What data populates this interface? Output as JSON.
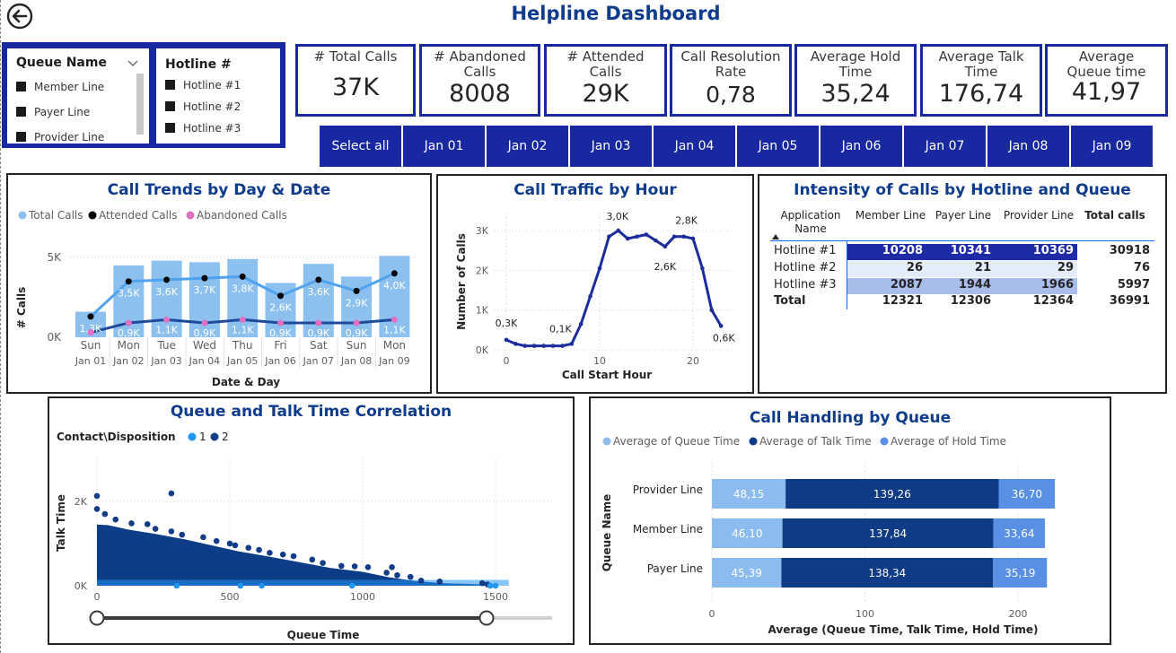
{
  "page": {
    "title": "Helpline Dashboard"
  },
  "slicers": {
    "queue_name": {
      "label": "Queue Name",
      "items": [
        "Member Line",
        "Payer Line",
        "Provider Line"
      ]
    },
    "hotline": {
      "label": "Hotline #",
      "items": [
        "Hotline #1",
        "Hotline #2",
        "Hotline #3"
      ]
    }
  },
  "kpis": [
    {
      "label": "# Total Calls",
      "value": "37K"
    },
    {
      "label": "# Abandoned Calls",
      "value": "8008"
    },
    {
      "label": "# Attended Calls",
      "value": "29K"
    },
    {
      "label": "Call Resolution Rate",
      "value": "0,78"
    },
    {
      "label": "Average Hold Time",
      "value": "35,24"
    },
    {
      "label": "Average Talk Time",
      "value": "176,74"
    },
    {
      "label": "Average Queue time",
      "value": "41,97"
    }
  ],
  "date_buttons": [
    "Select all",
    "Jan 01",
    "Jan 02",
    "Jan 03",
    "Jan 04",
    "Jan 05",
    "Jan 06",
    "Jan 07",
    "Jan 08",
    "Jan 09"
  ],
  "colors": {
    "brand": "#1728a0",
    "title": "#0e3b8c",
    "bar": "#8cc0ef",
    "attended": "#000000",
    "abandoned": "#e36fc0",
    "line1": "#4fa3ee",
    "line2": "#1f4a9a",
    "traffic": "#1b2d9c"
  },
  "trend_chart": {
    "title": "Call Trends by Day & Date",
    "legend": [
      "Total Calls",
      "Attended Calls",
      "Abandoned Calls"
    ],
    "xlabel": "Date & Day",
    "ylabel": "# Calls",
    "yticks": [
      "0K",
      "5K"
    ],
    "days": [
      "Sun",
      "Mon",
      "Tue",
      "Wed",
      "Thu",
      "Fri",
      "Sat",
      "Sun",
      "Mon"
    ],
    "dates": [
      "Jan 01",
      "Jan 02",
      "Jan 03",
      "Jan 04",
      "Jan 05",
      "Jan 06",
      "Jan 07",
      "Jan 08",
      "Jan 09"
    ]
  },
  "traffic_chart": {
    "title": "Call Traffic by Hour",
    "xlabel": "Call Start Hour",
    "ylabel": "Number of Calls",
    "yticks": [
      "0K",
      "1K",
      "2K",
      "3K"
    ],
    "xticks": [
      "0",
      "10",
      "20"
    ]
  },
  "matrix": {
    "title": "Intensity of Calls by Hotline and Queue",
    "headers": [
      "Application Name",
      "Member Line",
      "Payer Line",
      "Provider Line",
      "Total calls"
    ],
    "rows": [
      {
        "name": "Hotline #1",
        "cells": [
          "10208",
          "10341",
          "10369"
        ],
        "total": "30918"
      },
      {
        "name": "Hotline #2",
        "cells": [
          "26",
          "21",
          "29"
        ],
        "total": "76"
      },
      {
        "name": "Hotline #3",
        "cells": [
          "2087",
          "1944",
          "1966"
        ],
        "total": "5997"
      }
    ],
    "total": {
      "name": "Total",
      "cells": [
        "12321",
        "12306",
        "12364"
      ],
      "total": "36991"
    }
  },
  "scatter": {
    "title": "Queue and Talk Time Correlation",
    "legend_title": "Contact\\Disposition",
    "legend": [
      "1",
      "2"
    ],
    "xlabel": "Queue Time",
    "ylabel": "Talk Time",
    "xticks": [
      "0",
      "500",
      "1000",
      "1500"
    ],
    "yticks": [
      "0K",
      "2K"
    ],
    "slider": {
      "min": 0,
      "max": 1500
    }
  },
  "handling": {
    "title": "Call Handling by Queue",
    "legend": [
      "Average of Queue Time",
      "Average of Talk Time",
      "Average of Hold Time"
    ],
    "xlabel": "Average (Queue Time, Talk Time, Hold Time)",
    "ylabel": "Queue Name",
    "xticks": [
      "0",
      "100",
      "200"
    ]
  },
  "chart_data": [
    {
      "type": "bar",
      "title": "Call Trends by Day & Date",
      "categories": [
        "Jan 01",
        "Jan 02",
        "Jan 03",
        "Jan 04",
        "Jan 05",
        "Jan 06",
        "Jan 07",
        "Jan 08",
        "Jan 09"
      ],
      "series": [
        {
          "name": "Total Calls",
          "values": [
            1600,
            4500,
            4800,
            4700,
            4900,
            3400,
            4600,
            3800,
            5100
          ]
        },
        {
          "name": "Attended Calls",
          "values": [
            1300,
            3500,
            3600,
            3700,
            3800,
            2600,
            3600,
            2900,
            4000
          ],
          "labels": [
            "1,3K",
            "3,5K",
            "3,6K",
            "3,7K",
            "3,8K",
            "2,6K",
            "3,6K",
            "2,9K",
            "4,0K"
          ]
        },
        {
          "name": "Abandoned Calls",
          "values": [
            300,
            900,
            1100,
            900,
            1100,
            900,
            900,
            900,
            1100
          ],
          "labels": [
            "",
            "0,9K",
            "1,1K",
            "0,9K",
            "1,1K",
            "0,9K",
            "0,9K",
            "0,9K",
            "1,1K"
          ]
        }
      ],
      "ylabel": "# Calls",
      "xlabel": "Date & Day",
      "ylim": [
        0,
        6000
      ]
    },
    {
      "type": "line",
      "title": "Call Traffic by Hour",
      "x": [
        0,
        1,
        2,
        3,
        4,
        5,
        6,
        7,
        8,
        9,
        10,
        11,
        12,
        13,
        14,
        15,
        16,
        17,
        18,
        19,
        20,
        21,
        22,
        23
      ],
      "values": [
        250,
        150,
        100,
        100,
        100,
        100,
        100,
        150,
        650,
        1350,
        2050,
        2850,
        3000,
        2800,
        2850,
        2900,
        2750,
        2600,
        2850,
        2850,
        2800,
        2050,
        1000,
        600
      ],
      "labels": {
        "0": "0,3K",
        "6": "0,1K",
        "12": "3,0K",
        "17": "2,6K",
        "19": "2,8K",
        "23": "0,6K"
      },
      "xlabel": "Call Start Hour",
      "ylabel": "Number of Calls",
      "ylim": [
        0,
        3300
      ],
      "xlim": [
        -1,
        24
      ]
    },
    {
      "type": "scatter",
      "title": "Queue and Talk Time Correlation",
      "xlabel": "Queue Time",
      "ylabel": "Talk Time",
      "xlim": [
        0,
        1720
      ],
      "ylim": [
        0,
        2600
      ],
      "series": [
        {
          "name": "1",
          "points": [
            [
              540,
              0
            ],
            [
              960,
              0
            ],
            [
              1480,
              0
            ],
            [
              1500,
              0
            ],
            [
              300,
              0
            ],
            [
              620,
              0
            ]
          ]
        },
        {
          "name": "2",
          "points": [
            [
              0,
              2130
            ],
            [
              280,
              2190
            ],
            [
              0,
              1820
            ],
            [
              30,
              1700
            ],
            [
              70,
              1570
            ],
            [
              130,
              1480
            ],
            [
              190,
              1460
            ],
            [
              220,
              1350
            ],
            [
              280,
              1290
            ],
            [
              320,
              1210
            ],
            [
              400,
              1150
            ],
            [
              450,
              1060
            ],
            [
              500,
              1000
            ],
            [
              520,
              960
            ],
            [
              570,
              900
            ],
            [
              610,
              850
            ],
            [
              650,
              780
            ],
            [
              700,
              740
            ],
            [
              740,
              700
            ],
            [
              810,
              620
            ],
            [
              850,
              540
            ],
            [
              920,
              470
            ],
            [
              970,
              460
            ],
            [
              1020,
              440
            ],
            [
              1090,
              310
            ],
            [
              1110,
              440
            ],
            [
              1130,
              250
            ],
            [
              1180,
              210
            ],
            [
              1220,
              120
            ],
            [
              1290,
              100
            ],
            [
              1450,
              60
            ],
            [
              1470,
              30
            ]
          ]
        }
      ]
    },
    {
      "type": "bar",
      "title": "Call Handling by Queue",
      "categories": [
        "Provider Line",
        "Member Line",
        "Payer Line"
      ],
      "series": [
        {
          "name": "Average of Queue Time",
          "values": [
            48.15,
            46.1,
            45.39
          ],
          "labels": [
            "48,15",
            "46,10",
            "45,39"
          ]
        },
        {
          "name": "Average of Talk Time",
          "values": [
            139.26,
            137.84,
            138.34
          ],
          "labels": [
            "139,26",
            "137,84",
            "138,34"
          ]
        },
        {
          "name": "Average of Hold Time",
          "values": [
            36.7,
            33.64,
            35.19
          ],
          "labels": [
            "36,70",
            "33,64",
            "35,19"
          ]
        }
      ],
      "xlabel": "Average (Queue Time, Talk Time, Hold Time)",
      "ylabel": "Queue Name",
      "xlim": [
        0,
        250
      ]
    }
  ]
}
